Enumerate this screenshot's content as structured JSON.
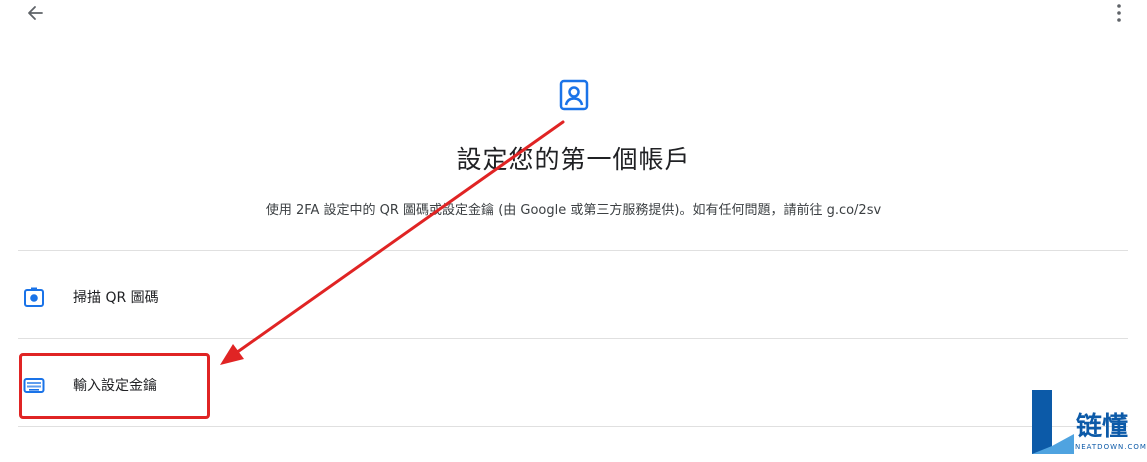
{
  "header": {
    "back_icon": "arrow-left-icon",
    "more_icon": "more-vert-icon"
  },
  "hero": {
    "icon": "account-box-icon",
    "title": "設定您的第一個帳戶",
    "description": "使用 2FA 設定中的 QR 圖碼或設定金鑰 (由 Google 或第三方服務提供)。如有任何問題，請前往 g.co/2sv"
  },
  "options": [
    {
      "icon": "camera-scan-icon",
      "label": "掃描 QR 圖碼"
    },
    {
      "icon": "keyboard-icon",
      "label": "輸入設定金鑰"
    }
  ],
  "colors": {
    "accent": "#1a73e8",
    "annotation": "#e02424",
    "watermark": "#0c5aa8"
  },
  "watermark": {
    "brand": "链懂",
    "sub": "NEATDOWN.COM"
  }
}
